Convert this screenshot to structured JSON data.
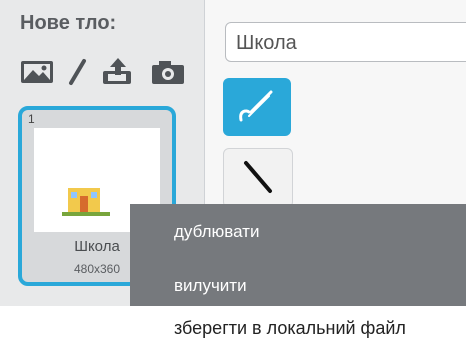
{
  "backdrop_panel": {
    "title": "Нове тло:",
    "icons": [
      "image-icon",
      "paint-brush-icon",
      "upload-icon",
      "camera-icon"
    ]
  },
  "backdrop_card": {
    "number": "1",
    "name": "Школа",
    "size": "480x360"
  },
  "editor": {
    "name_value": "Школа",
    "tools": [
      "brush-tool-icon",
      "line-tool-icon"
    ]
  },
  "context_menu": {
    "items": [
      "дублювати",
      "вилучити"
    ]
  },
  "bottom_menu_item": "зберегти в локальний файл",
  "colors": {
    "accent": "#2aa8d9",
    "menu_bg": "#76797d",
    "panel_bg": "#e8e9ea"
  }
}
